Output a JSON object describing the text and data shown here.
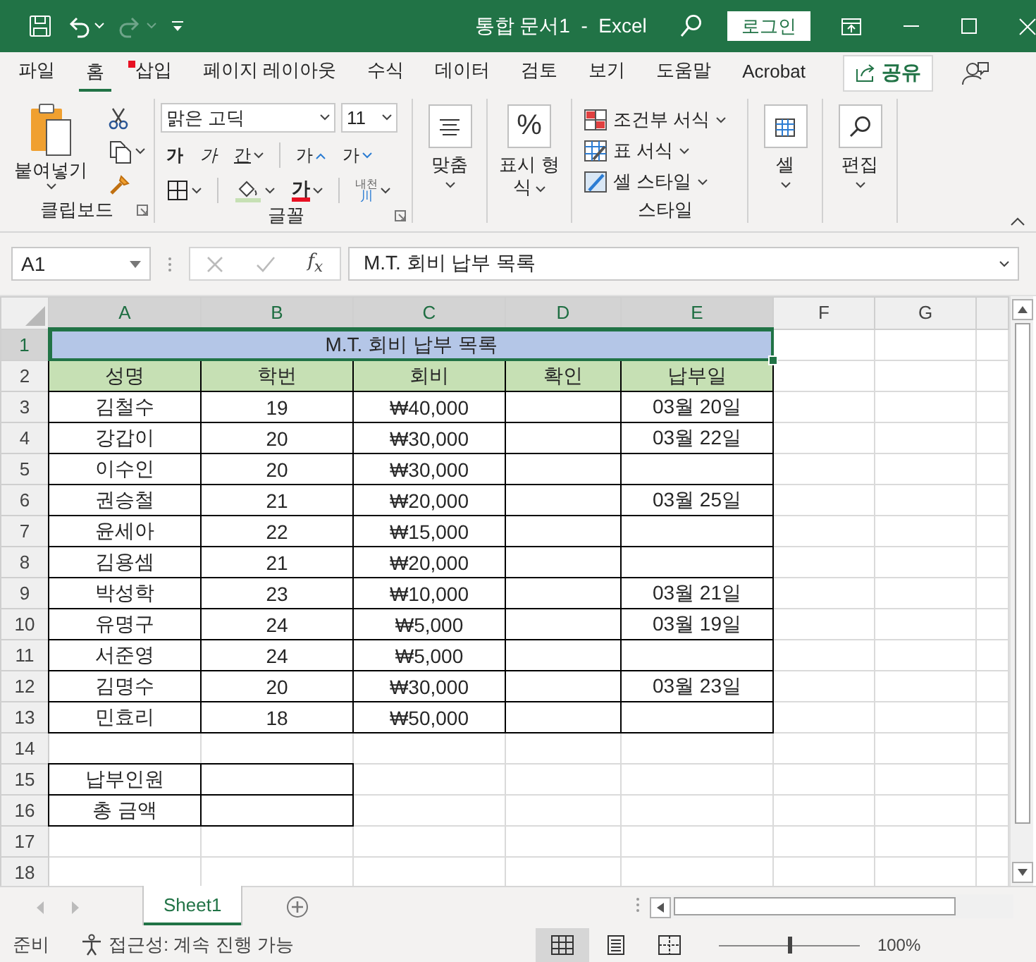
{
  "title_bar": {
    "title": "통합 문서1  -  Excel",
    "sign_in": "로그인"
  },
  "ribbon_tabs": [
    {
      "label": "파일",
      "selected": false,
      "marked": false
    },
    {
      "label": "홈",
      "selected": true,
      "marked": false
    },
    {
      "label": "삽입",
      "selected": false,
      "marked": true
    },
    {
      "label": "페이지 레이아웃",
      "selected": false,
      "marked": false
    },
    {
      "label": "수식",
      "selected": false,
      "marked": false
    },
    {
      "label": "데이터",
      "selected": false,
      "marked": false
    },
    {
      "label": "검토",
      "selected": false,
      "marked": false
    },
    {
      "label": "보기",
      "selected": false,
      "marked": false
    },
    {
      "label": "도움말",
      "selected": false,
      "marked": false
    },
    {
      "label": "Acrobat",
      "selected": false,
      "marked": false
    }
  ],
  "share": "공유",
  "ribbon": {
    "clipboard": {
      "paste": "붙여넣기",
      "label": "클립보드"
    },
    "font": {
      "name": "맑은 고딕",
      "size": "11",
      "bold": "가",
      "italic": "가",
      "underline": "간",
      "grow": "가",
      "shrink": "가",
      "color_button": "가",
      "phonetic": "내천",
      "phonetic_mark": "川",
      "label": "글꼴"
    },
    "alignment": {
      "label": "맞춤"
    },
    "number": {
      "symbol": "%",
      "label": "표시 형식"
    },
    "styles": {
      "items": [
        {
          "kind": "conditional",
          "label": "조건부 서식"
        },
        {
          "kind": "table",
          "label": "표 서식"
        },
        {
          "kind": "cell",
          "label": "셀 스타일"
        }
      ],
      "label": "스타일"
    },
    "cells": {
      "label": "셀"
    },
    "editing": {
      "label": "편집"
    }
  },
  "formula_bar": {
    "name_box": "A1",
    "fx": "f$_{x}$",
    "formula": "M.T. 회비 납부 목록"
  },
  "sheet": {
    "columns": [
      {
        "label": "A",
        "selected": true
      },
      {
        "label": "B",
        "selected": true
      },
      {
        "label": "C",
        "selected": true
      },
      {
        "label": "D",
        "selected": true
      },
      {
        "label": "E",
        "selected": true
      },
      {
        "label": "F",
        "selected": false
      },
      {
        "label": "G",
        "selected": false
      }
    ],
    "rows": [
      {
        "number": "1",
        "selected": true,
        "kind": "title",
        "cells": {
          "title": "M.T. 회비 납부 목록"
        }
      },
      {
        "number": "2",
        "selected": false,
        "kind": "header",
        "cells": {
          "name": "성명",
          "student_no": "학번",
          "fee": "회비",
          "confirmed": "확인",
          "paid_date": "납부일"
        }
      },
      {
        "number": "3",
        "selected": false,
        "kind": "data",
        "cells": {
          "name": "김철수",
          "student_no": "19",
          "fee": "₩40,000",
          "paid_date": "03월 20일"
        }
      },
      {
        "number": "4",
        "selected": false,
        "kind": "data",
        "cells": {
          "name": "강갑이",
          "student_no": "20",
          "fee": "₩30,000",
          "paid_date": "03월 22일"
        }
      },
      {
        "number": "5",
        "selected": false,
        "kind": "data",
        "cells": {
          "name": "이수인",
          "student_no": "20",
          "fee": "₩30,000"
        }
      },
      {
        "number": "6",
        "selected": false,
        "kind": "data",
        "cells": {
          "name": "권승철",
          "student_no": "21",
          "fee": "₩20,000",
          "paid_date": "03월 25일"
        }
      },
      {
        "number": "7",
        "selected": false,
        "kind": "data",
        "cells": {
          "name": "윤세아",
          "student_no": "22",
          "fee": "₩15,000"
        }
      },
      {
        "number": "8",
        "selected": false,
        "kind": "data",
        "cells": {
          "name": "김용셈",
          "student_no": "21",
          "fee": "₩20,000"
        }
      },
      {
        "number": "9",
        "selected": false,
        "kind": "data",
        "cells": {
          "name": "박성학",
          "student_no": "23",
          "fee": "₩10,000",
          "paid_date": "03월 21일"
        }
      },
      {
        "number": "10",
        "selected": false,
        "kind": "data",
        "cells": {
          "name": "유명구",
          "student_no": "24",
          "fee": "₩5,000",
          "paid_date": "03월 19일"
        }
      },
      {
        "number": "11",
        "selected": false,
        "kind": "data",
        "cells": {
          "name": "서준영",
          "student_no": "24",
          "fee": "₩5,000"
        }
      },
      {
        "number": "12",
        "selected": false,
        "kind": "data",
        "cells": {
          "name": "김명수",
          "student_no": "20",
          "fee": "₩30,000",
          "paid_date": "03월 23일"
        }
      },
      {
        "number": "13",
        "selected": false,
        "kind": "data",
        "cells": {
          "name": "민효리",
          "student_no": "18",
          "fee": "₩50,000"
        }
      },
      {
        "number": "14",
        "selected": false,
        "kind": "empty"
      },
      {
        "number": "15",
        "selected": false,
        "kind": "summary",
        "cells": {
          "label": "납부인원"
        }
      },
      {
        "number": "16",
        "selected": false,
        "kind": "summary",
        "cells": {
          "label": "총 금액"
        }
      },
      {
        "number": "17",
        "selected": false,
        "kind": "empty"
      },
      {
        "number": "18",
        "selected": false,
        "kind": "empty"
      }
    ]
  },
  "sheet_tabs": [
    {
      "label": "Sheet1",
      "selected": true
    }
  ],
  "status_bar": {
    "mode": "준비",
    "accessibility": "접근성: 계속 진행 가능",
    "views": [
      {
        "kind": "normal",
        "selected": true
      },
      {
        "kind": "page_layout",
        "selected": false
      },
      {
        "kind": "page_break",
        "selected": false
      }
    ],
    "zoom": {
      "label": "100%",
      "level": 0.5
    }
  }
}
